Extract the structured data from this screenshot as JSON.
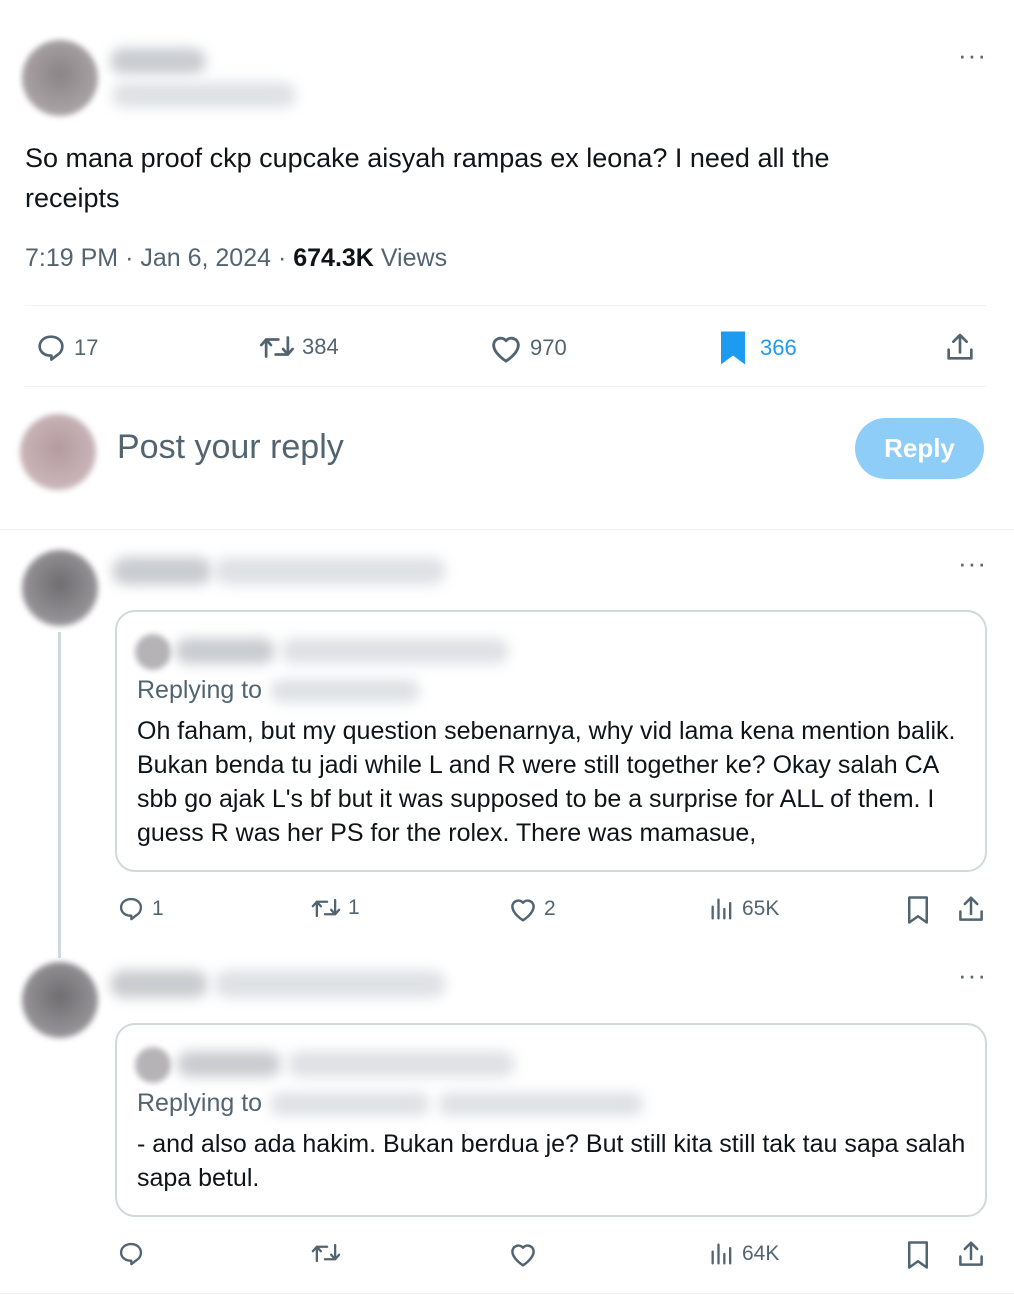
{
  "main_post": {
    "text": "So mana proof ckp cupcake aisyah rampas ex leona?  I need all the receipts",
    "time": "7:19 PM",
    "date": "Jan 6, 2024",
    "views_count": "674.3K",
    "views_label": "Views",
    "stats": {
      "replies": "17",
      "reposts": "384",
      "likes": "970",
      "bookmarks": "366"
    },
    "bookmark_color": "#1d9bf0"
  },
  "composer": {
    "placeholder": "Post your reply",
    "button": "Reply",
    "button_color": "#8ecdf8"
  },
  "replies": [
    {
      "replying_to_label": "Replying to",
      "text": "Oh faham, but my question sebenarnya, why vid lama kena mention balik. Bukan benda tu jadi while L and R were still together ke? Okay salah CA sbb go ajak L's bf but it was supposed to be a surprise for ALL of them. I guess R was her PS for the rolex. There was mamasue,",
      "stats": {
        "replies": "1",
        "reposts": "1",
        "likes": "2",
        "views": "65K"
      }
    },
    {
      "replying_to_label": "Replying to",
      "text": "- and also ada hakim. Bukan berdua je? But still kita still tak tau sapa salah sapa betul.",
      "stats": {
        "replies": "",
        "reposts": "",
        "likes": "",
        "views": "64K"
      }
    }
  ],
  "icons": [
    "more-icon",
    "reply-icon",
    "repost-icon",
    "like-icon",
    "bookmark-icon",
    "share-icon",
    "views-icon"
  ]
}
